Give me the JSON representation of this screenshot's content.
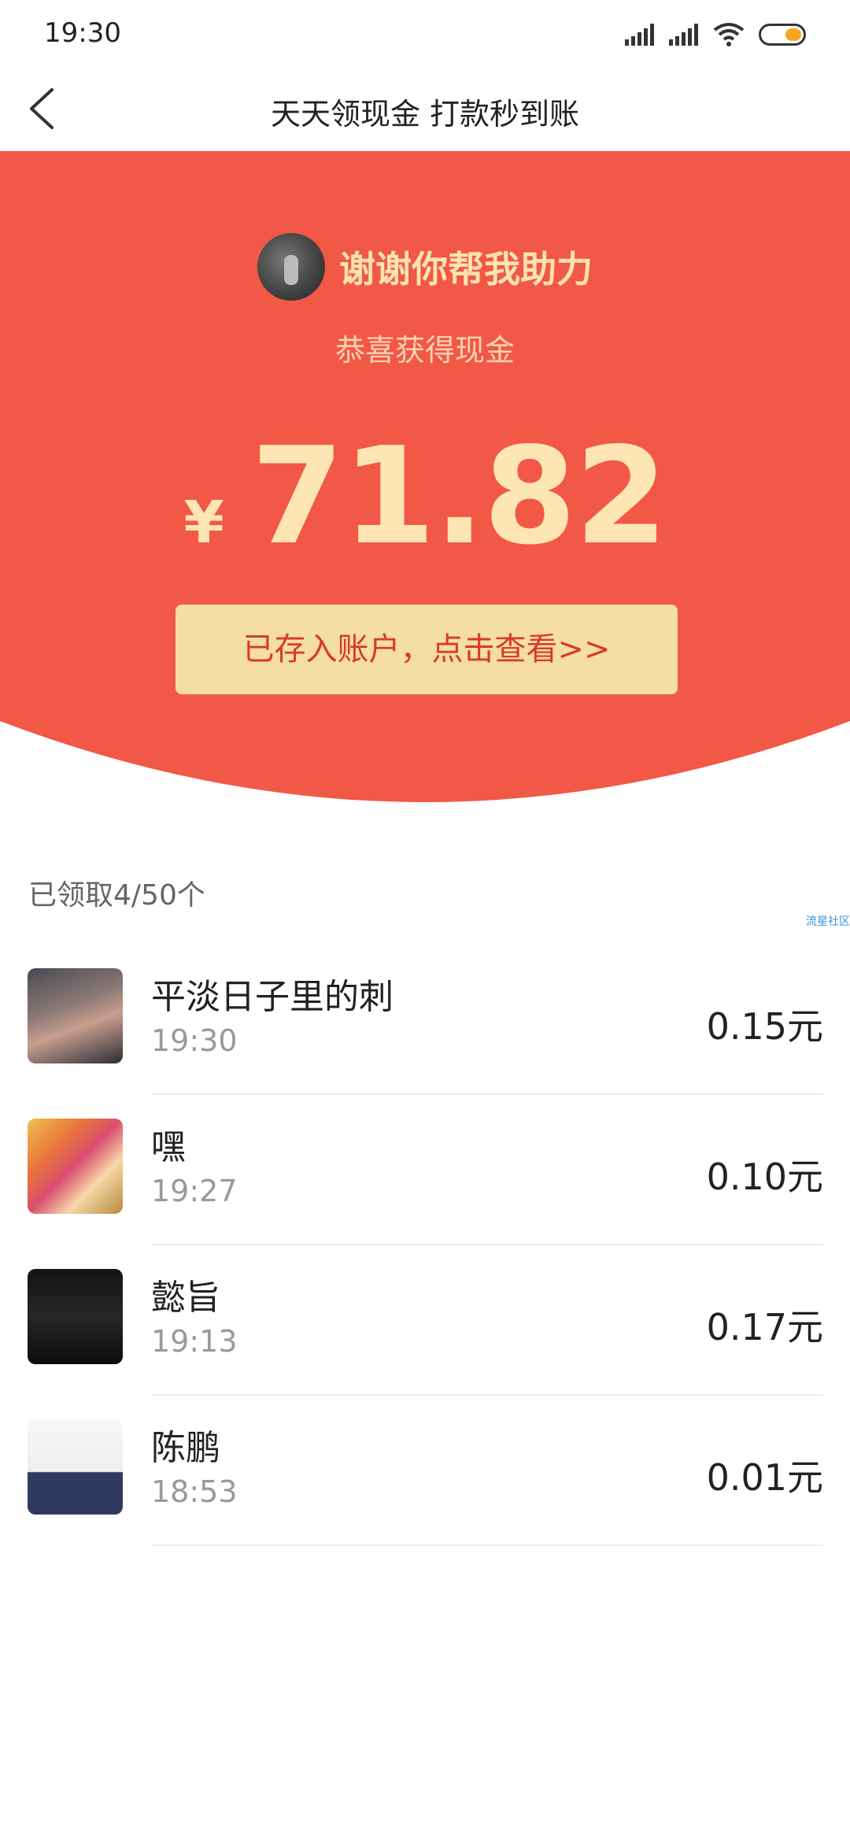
{
  "status_bar": {
    "time": "19:30"
  },
  "header": {
    "title": "天天领现金 打款秒到账"
  },
  "reward": {
    "thanks": "谢谢你帮我助力",
    "congrats": "恭喜获得现金",
    "currency": "¥",
    "amount": "71.82",
    "button": "已存入账户，点击查看>>"
  },
  "claimed": {
    "label": "已领取4/50个",
    "watermark": "流星社区"
  },
  "list": [
    {
      "name": "平淡日子里的刺",
      "time": "19:30",
      "amount": "0.15元"
    },
    {
      "name": "嘿",
      "time": "19:27",
      "amount": "0.10元"
    },
    {
      "name": "懿旨",
      "time": "19:13",
      "amount": "0.17元"
    },
    {
      "name": "陈鹏",
      "time": "18:53",
      "amount": "0.01元"
    }
  ],
  "colors": {
    "red": "#f25846",
    "button_bg": "#f4dea3",
    "button_text": "#d93a2b",
    "amount_text": "#fde5b4"
  }
}
